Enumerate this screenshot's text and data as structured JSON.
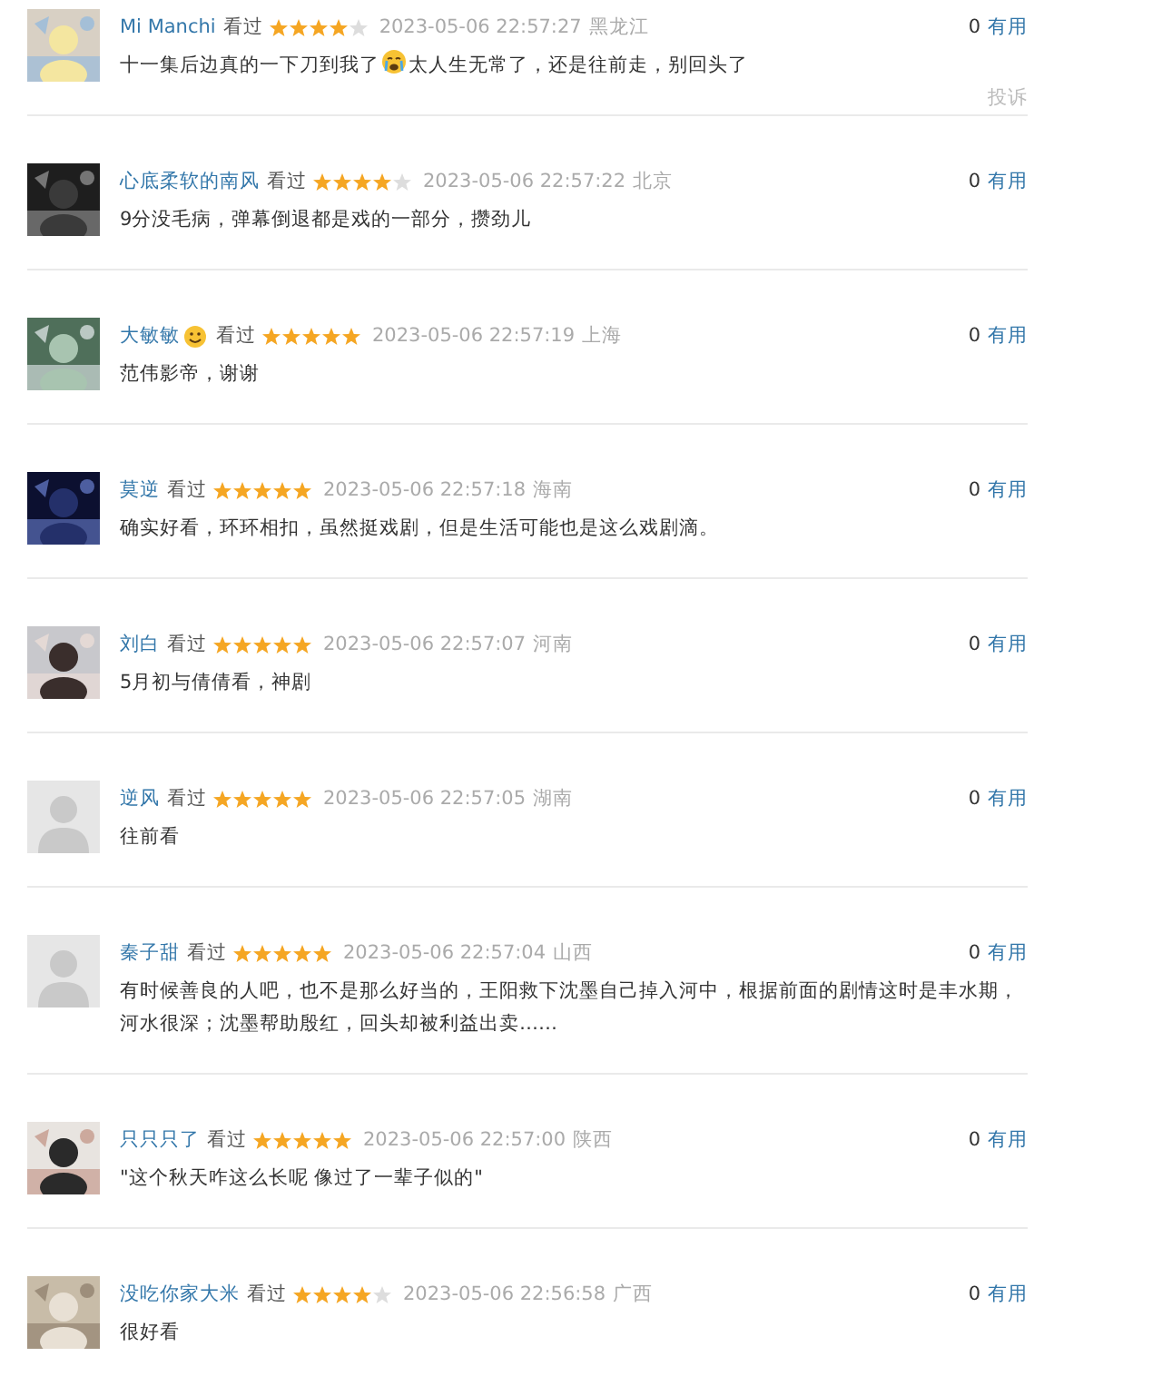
{
  "comments": [
    {
      "name": "Mi Manchi",
      "status": "看过",
      "stars": 4,
      "time": "2023-05-06 22:57:27",
      "location": "黑龙江",
      "votes": "0",
      "vote_label": "有用",
      "report": "投诉",
      "content": [
        {
          "kind": "text",
          "text": "十一集后边真的一下刀到我了"
        },
        {
          "kind": "crying_face"
        },
        {
          "kind": "text",
          "text": "太人生无常了，还是往前走，别回头了"
        }
      ]
    },
    {
      "name": "心底柔软的南风",
      "status": "看过",
      "stars": 4,
      "time": "2023-05-06 22:57:22",
      "location": "北京",
      "votes": "0",
      "vote_label": "有用",
      "content": [
        {
          "kind": "text",
          "text": "9分没毛病，弹幕倒退都是戏的一部分，攒劲儿"
        }
      ]
    },
    {
      "name": "大敏敏",
      "name_icon": {
        "kind": "smiling_face"
      },
      "status": "看过",
      "stars": 5,
      "time": "2023-05-06 22:57:19",
      "location": "上海",
      "votes": "0",
      "vote_label": "有用",
      "content": [
        {
          "kind": "text",
          "text": "范伟影帝，谢谢"
        }
      ]
    },
    {
      "name": "莫逆",
      "status": "看过",
      "stars": 5,
      "time": "2023-05-06 22:57:18",
      "location": "海南",
      "votes": "0",
      "vote_label": "有用",
      "content": [
        {
          "kind": "text",
          "text": "确实好看，环环相扣，虽然挺戏剧，但是生活可能也是这么戏剧滴。"
        }
      ]
    },
    {
      "name": "刘白",
      "status": "看过",
      "stars": 5,
      "time": "2023-05-06 22:57:07",
      "location": "河南",
      "votes": "0",
      "vote_label": "有用",
      "content": [
        {
          "kind": "text",
          "text": "5月初与倩倩看，神剧"
        }
      ]
    },
    {
      "avatar": {
        "kind": "default"
      },
      "name": "逆风",
      "status": "看过",
      "stars": 5,
      "time": "2023-05-06 22:57:05",
      "location": "湖南",
      "votes": "0",
      "vote_label": "有用",
      "content": [
        {
          "kind": "text",
          "text": "往前看"
        }
      ]
    },
    {
      "avatar": {
        "kind": "default"
      },
      "name": "秦子甜",
      "status": "看过",
      "stars": 5,
      "time": "2023-05-06 22:57:04",
      "location": "山西",
      "votes": "0",
      "vote_label": "有用",
      "content": [
        {
          "kind": "text",
          "text": "有时候善良的人吧，也不是那么好当的，王阳救下沈墨自己掉入河中，根据前面的剧情这时是丰水期，河水很深；沈墨帮助殷红，回头却被利益出卖……"
        }
      ]
    },
    {
      "name": "只只只了",
      "status": "看过",
      "stars": 5,
      "time": "2023-05-06 22:57:00",
      "location": "陕西",
      "votes": "0",
      "vote_label": "有用",
      "content": [
        {
          "kind": "text",
          "text": "\"这个秋天咋这么长呢 像过了一辈子似的\""
        }
      ]
    },
    {
      "name": "没吃你家大米",
      "status": "看过",
      "stars": 4,
      "time": "2023-05-06 22:56:58",
      "location": "广西",
      "votes": "0",
      "vote_label": "有用",
      "content": [
        {
          "kind": "text",
          "text": "很好看"
        }
      ]
    }
  ]
}
